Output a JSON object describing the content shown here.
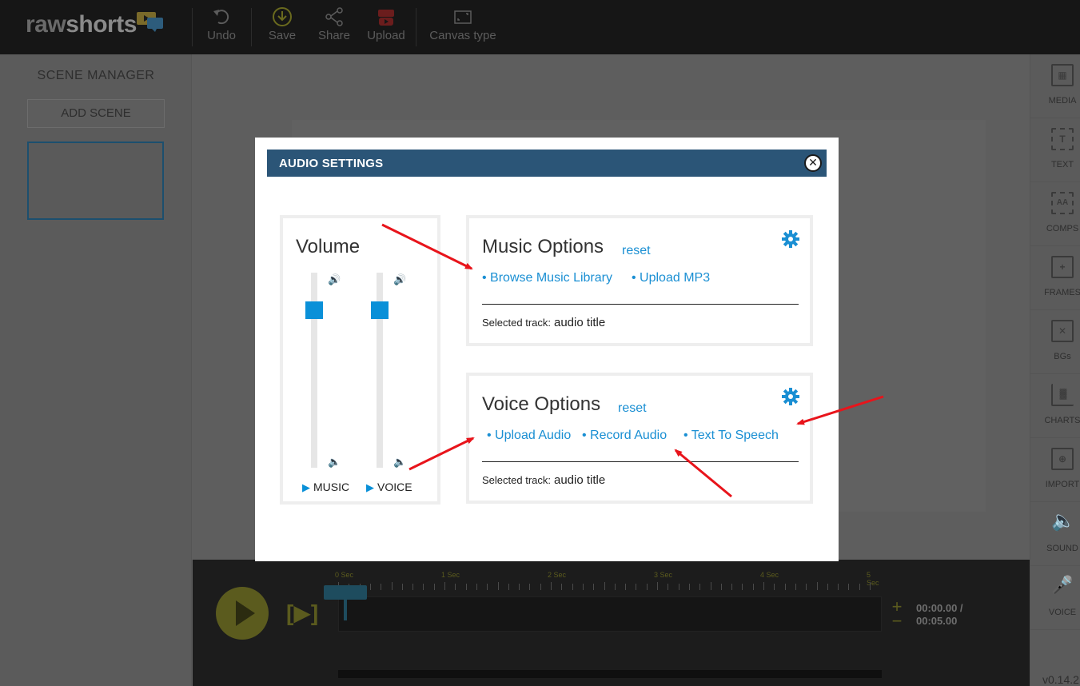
{
  "app": {
    "logo_raw": "raw",
    "logo_shorts": "shorts",
    "version": "v0.14.2"
  },
  "toolbar": {
    "undo": "Undo",
    "save": "Save",
    "share": "Share",
    "upload": "Upload",
    "canvas_type": "Canvas type"
  },
  "scene_manager": {
    "title": "SCENE MANAGER",
    "add_scene": "ADD SCENE"
  },
  "right_tools": [
    {
      "label": "MEDIA",
      "icon": "image-icon"
    },
    {
      "label": "TEXT",
      "icon": "text-icon"
    },
    {
      "label": "COMPS",
      "icon": "comps-icon"
    },
    {
      "label": "FRAMES",
      "icon": "frames-icon"
    },
    {
      "label": "BGs",
      "icon": "backgrounds-icon"
    },
    {
      "label": "CHARTS",
      "icon": "chart-icon"
    },
    {
      "label": "IMPORT",
      "icon": "import-icon"
    },
    {
      "label": "SOUND",
      "icon": "speaker-icon"
    },
    {
      "label": "VOICE",
      "icon": "microphone-icon"
    }
  ],
  "timeline": {
    "ticks": [
      "0 Sec",
      "1 Sec",
      "2 Sec",
      "3 Sec",
      "4 Sec",
      "5 Sec"
    ],
    "current_time": "00:00.00 /",
    "total_time": "00:05.00",
    "zoom_in": "+",
    "zoom_out": "−"
  },
  "modal": {
    "title": "AUDIO SETTINGS",
    "volume": {
      "title": "Volume",
      "music_label": "MUSIC",
      "voice_label": "VOICE",
      "music_level": 0.84,
      "voice_level": 0.84
    },
    "music": {
      "title": "Music Options",
      "reset": "reset",
      "links": [
        "• Browse Music Library",
        "• Upload MP3"
      ],
      "selected_label": "Selected track:",
      "selected_value": "audio title"
    },
    "voice": {
      "title": "Voice Options",
      "reset": "reset",
      "links": [
        "• Upload Audio",
        "• Record Audio",
        "• Text To Speech"
      ],
      "selected_label": "Selected track:",
      "selected_value": "audio title"
    }
  },
  "colors": {
    "accent": "#1a8fd3",
    "header": "#2b5577",
    "slider": "#0a90d8",
    "arrow": "#e8141b"
  }
}
